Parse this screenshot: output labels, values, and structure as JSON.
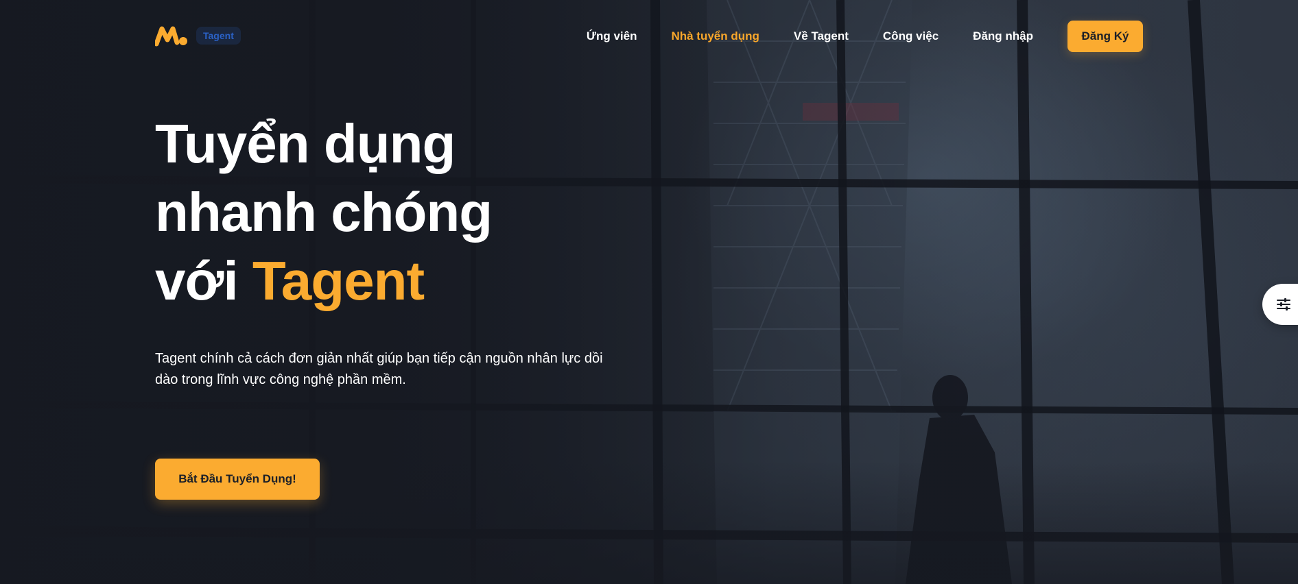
{
  "header": {
    "logo_badge": "Tagent",
    "nav": [
      {
        "label": "Ứng viên",
        "active": false
      },
      {
        "label": "Nhà tuyển dụng",
        "active": true
      },
      {
        "label": "Về Tagent",
        "active": false
      },
      {
        "label": "Công việc",
        "active": false
      },
      {
        "label": "Đăng nhập",
        "active": false
      }
    ],
    "register_label": "Đăng Ký"
  },
  "hero": {
    "title_line1": "Tuyển dụng",
    "title_line2": "nhanh chóng",
    "title_line3_prefix": "với",
    "title_line3_accent": "Tagent",
    "description": "Tagent chính cả cách đơn giản nhất giúp bạn tiếp cận nguồn nhân lực dồi dào trong lĩnh vực công nghệ phần mềm.",
    "cta_label": "Bắt Đầu Tuyển Dụng!"
  },
  "side_panel": {
    "icon": "sliders-icon"
  },
  "colors": {
    "accent": "#fbab30",
    "background": "#1a1e26",
    "badge_text": "#2b62c7",
    "text": "#ffffff"
  }
}
